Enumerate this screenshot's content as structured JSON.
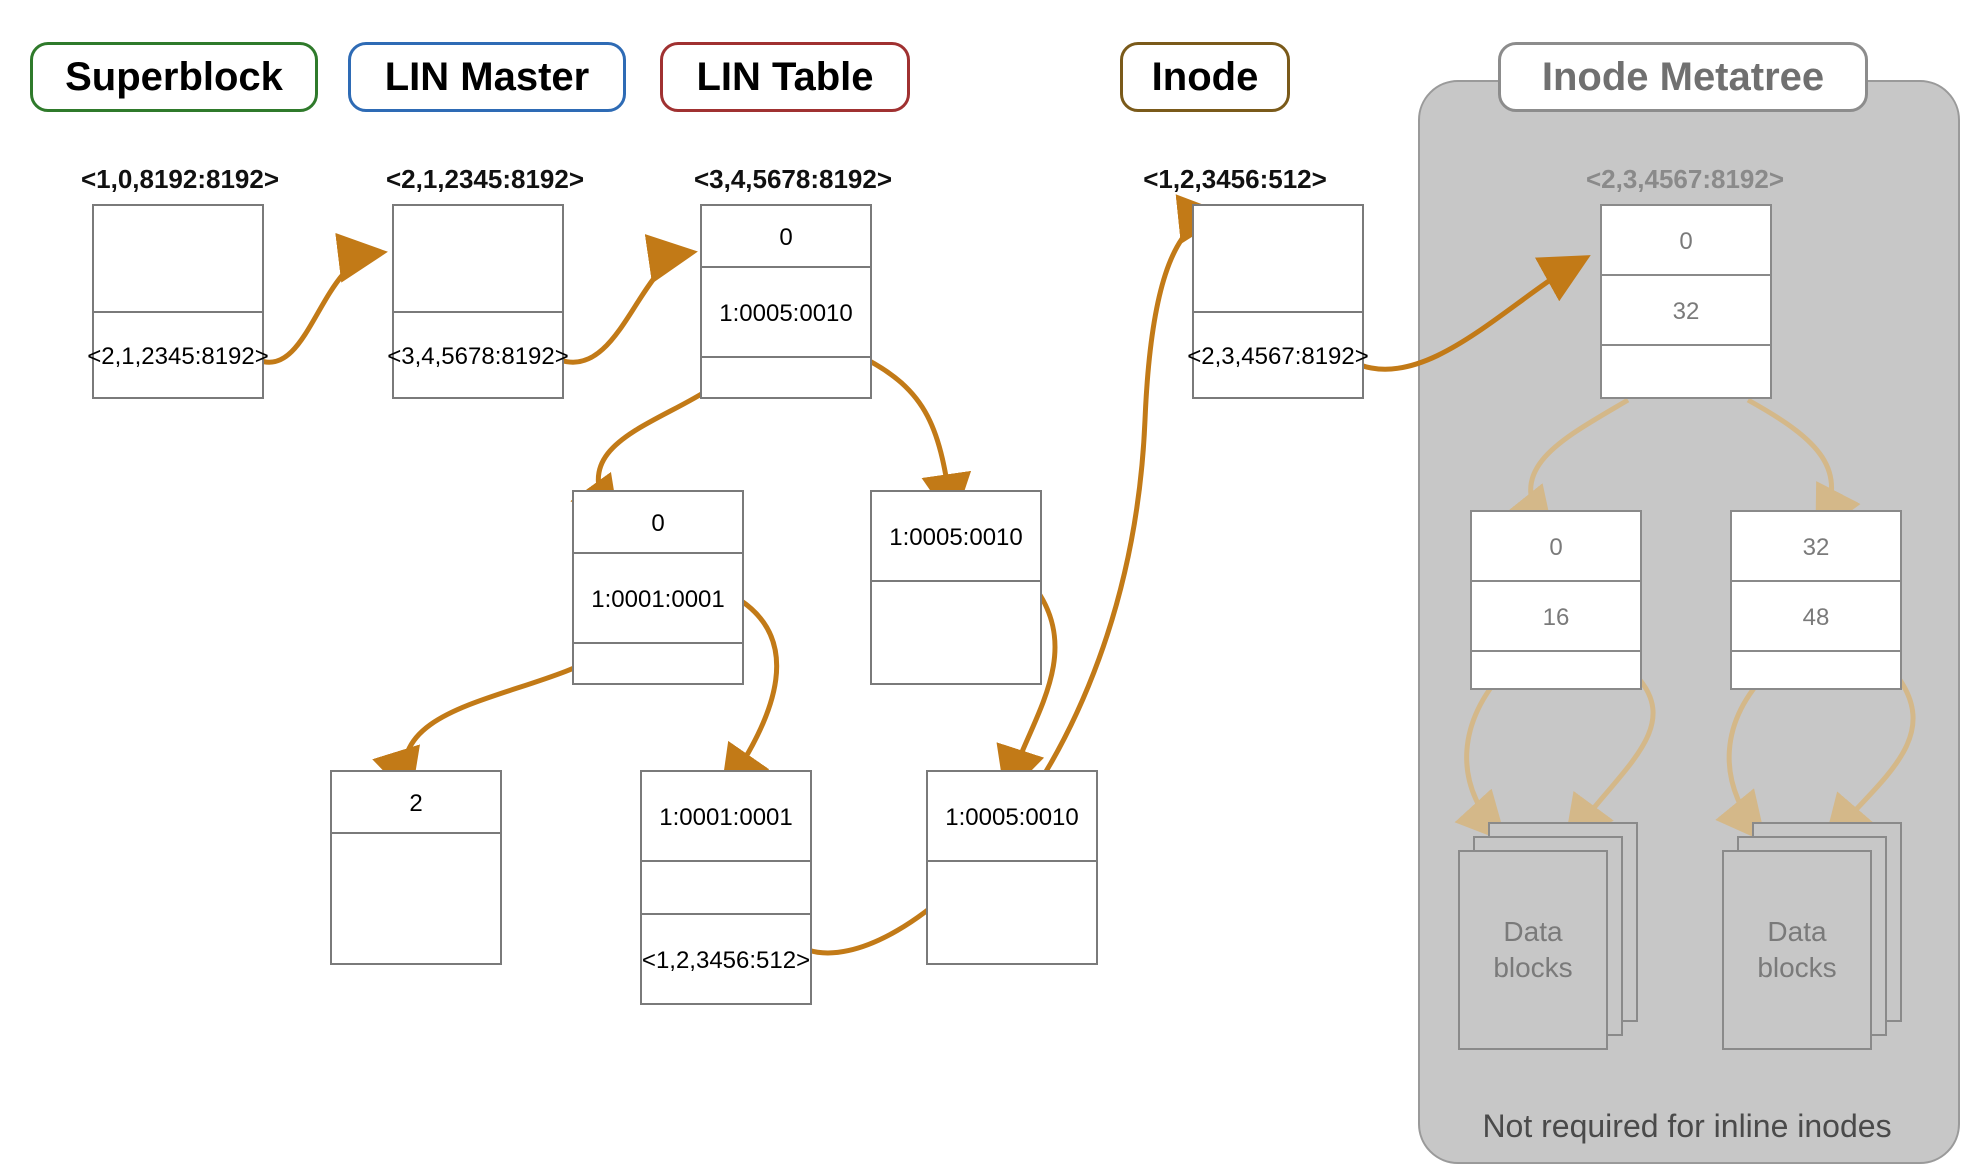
{
  "colors": {
    "arrow": "#c27a17",
    "arrowFaded": "#d4b889",
    "superblock": "#2f7a2b",
    "linmaster": "#2e6bb5",
    "lintable": "#a03131",
    "inode": "#7a5a1a",
    "metatree": "#8c8c8c"
  },
  "headers": {
    "superblock": "Superblock",
    "linmaster": "LIN Master",
    "lintable": "LIN Table",
    "inode": "Inode",
    "metatree": "Inode Metatree"
  },
  "addresses": {
    "superblock": "<1,0,8192:8192>",
    "linmaster": "<2,1,2345:8192>",
    "lintable": "<3,4,5678:8192>",
    "inode": "<1,2,3456:512>",
    "metatree": "<2,3,4567:8192>"
  },
  "nodes": {
    "superblock_ref": "<2,1,2345:8192>",
    "linmaster_ref": "<3,4,5678:8192>",
    "lintable_top": {
      "a": "0",
      "b": "1:0005:0010"
    },
    "lintable_mid_left": {
      "a": "0",
      "b": "1:0001:0001"
    },
    "lintable_mid_right": {
      "a": "1:0005:0010"
    },
    "lintable_leaf1": {
      "a": "2"
    },
    "lintable_leaf2": {
      "a": "1:0001:0001",
      "b": "<1,2,3456:512>"
    },
    "lintable_leaf3": {
      "a": "1:0005:0010"
    },
    "inode_ref": "<2,3,4567:8192>",
    "metatree_top": {
      "a": "0",
      "b": "32"
    },
    "metatree_mid_left": {
      "a": "0",
      "b": "16"
    },
    "metatree_mid_right": {
      "a": "32",
      "b": "48"
    },
    "datablocks_label": "Data blocks"
  },
  "footer": "Not required for inline inodes"
}
